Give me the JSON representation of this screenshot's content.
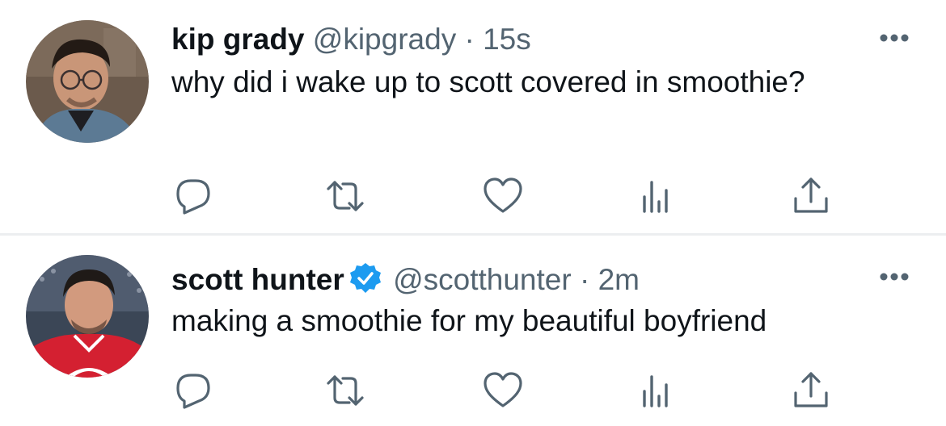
{
  "tweets": [
    {
      "name": "kip grady",
      "handle": "@kipgrady",
      "separator": "·",
      "time": "15s",
      "verified": false,
      "text": "why did i wake up to scott covered in smoothie?",
      "avatar_icon": "user-photo-glasses"
    },
    {
      "name": "scott hunter",
      "handle": "@scotthunter",
      "separator": "·",
      "time": "2m",
      "verified": true,
      "text": "making a smoothie for my beautiful boyfriend",
      "avatar_icon": "user-photo-hockey-jersey"
    }
  ],
  "actions": [
    "reply",
    "retweet",
    "like",
    "analytics",
    "share"
  ],
  "colors": {
    "text": "#0f1419",
    "secondary": "#536471",
    "verified": "#1d9bf0",
    "divider": "#eceef0",
    "icon": "#536471"
  }
}
